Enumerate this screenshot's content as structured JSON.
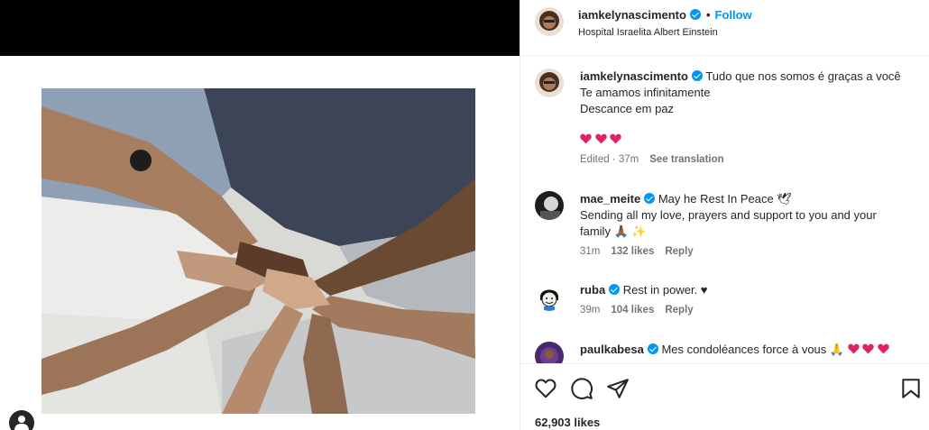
{
  "post": {
    "author": "iamkelynascimento",
    "follow_label": "Follow",
    "separator": "•",
    "location": "Hospital Israelita Albert Einstein"
  },
  "caption": {
    "user": "iamkelynascimento",
    "lines": [
      "Tudo que nos somos é graças a você",
      "Te amamos infinitamente",
      "Descance em paz"
    ],
    "time": "Edited · 37m",
    "translate_label": "See translation"
  },
  "comments": [
    {
      "user": "mae_meite",
      "text_line1": "May he Rest In Peace 🕊",
      "text_line2": "Sending all my love, prayers and support to you and your",
      "text_line3": "family 🙏🏾 ✨",
      "time": "31m",
      "likes": "132 likes",
      "reply": "Reply"
    },
    {
      "user": "ruba",
      "text": "Rest in power. ♥",
      "time": "39m",
      "likes": "104 likes",
      "reply": "Reply"
    },
    {
      "user": "paulkabesa",
      "text": "Mes condoléances force à vous 🙏"
    }
  ],
  "footer": {
    "likes": "62,903 likes"
  },
  "colors": {
    "accent": "#0095f6",
    "heart": "#e0245e",
    "muted": "#737373"
  },
  "icons": [
    "heart-icon",
    "comment-icon",
    "share-icon",
    "save-icon",
    "verified-icon",
    "user-tag-icon"
  ]
}
